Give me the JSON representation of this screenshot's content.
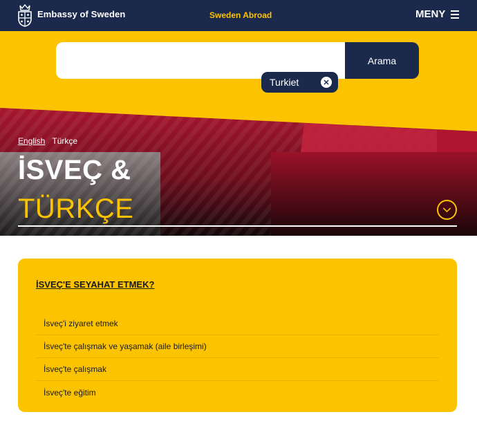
{
  "header": {
    "site_name": "Embassy of Sweden",
    "center_link": "Sweden Abroad",
    "menu_label": "MENY"
  },
  "search": {
    "input_value": "",
    "placeholder": "",
    "button_label": "Arama",
    "filter_chip": "Turkiet"
  },
  "hero": {
    "languages": [
      {
        "label": "English"
      },
      {
        "label": "Türkçe"
      }
    ],
    "title_line1": "İSVEÇ &",
    "title_line2": "TÜRKÇE"
  },
  "card": {
    "title": "İSVEÇ'E SEYAHAT ETMEK?",
    "links": [
      {
        "label": "İsveç'i ziyaret etmek"
      },
      {
        "label": "İsveç'te çalışmak ve yaşamak (aile birleşimi)"
      },
      {
        "label": "İsveç'te çalışmak"
      },
      {
        "label": "İsveç'te eğitim"
      }
    ]
  },
  "colors": {
    "navy": "#1b2a4c",
    "yellow": "#fbc300",
    "crimson": "#8b1126"
  }
}
